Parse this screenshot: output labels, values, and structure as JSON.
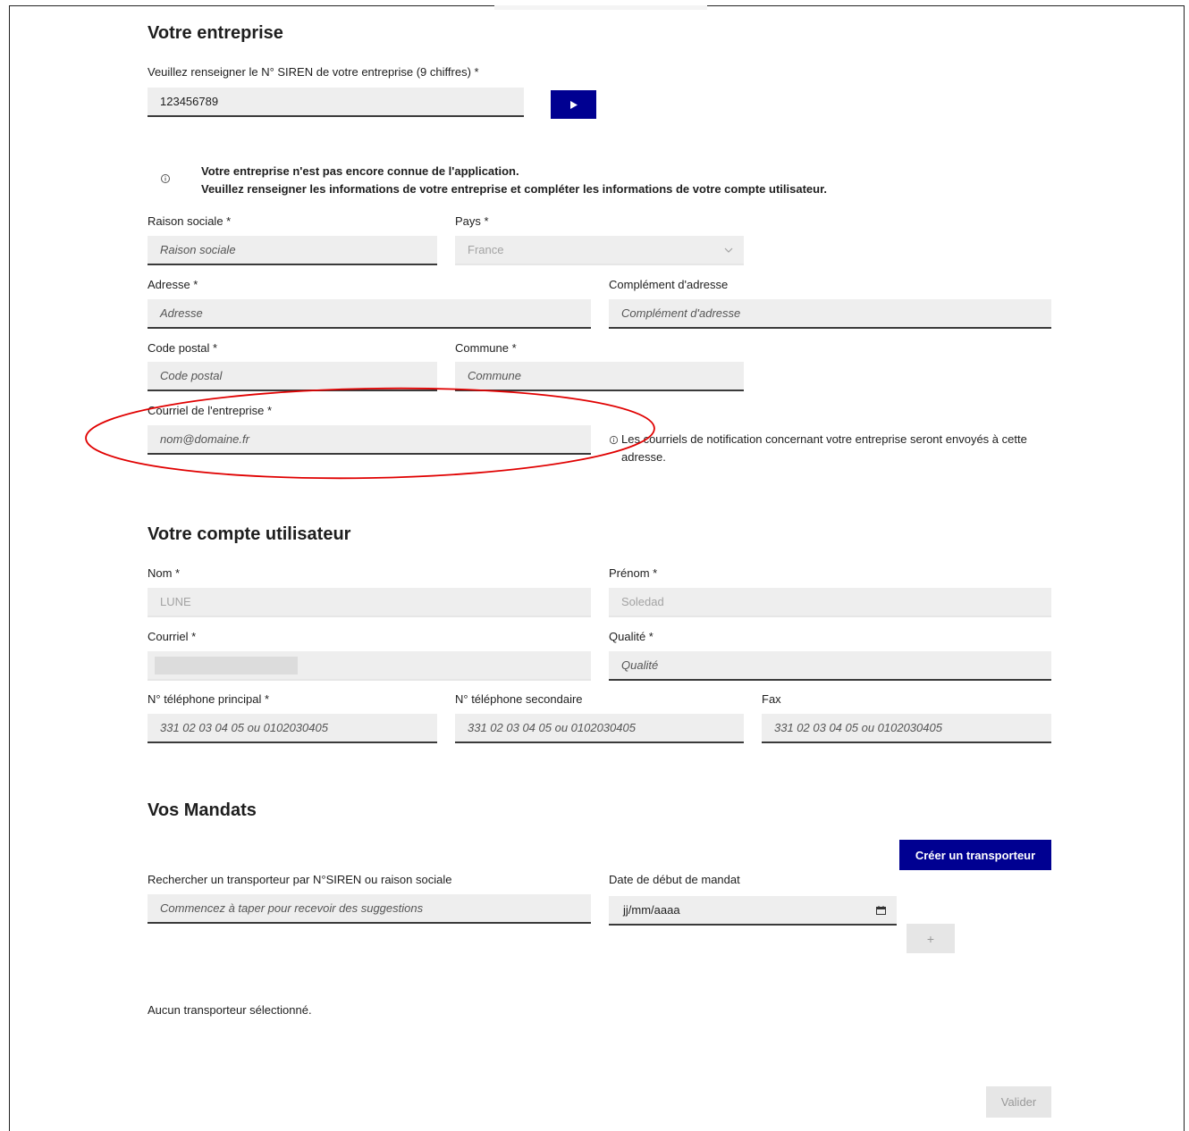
{
  "company": {
    "title": "Votre entreprise",
    "siren_label": "Veuillez renseigner le N° SIREN de votre entreprise (9 chiffres)  *",
    "siren_value": "123456789",
    "info_line1": "Votre entreprise n'est pas encore connue de l'application.",
    "info_line2": "Veuillez renseigner les informations de votre entreprise et compléter les informations de votre compte utilisateur.",
    "raison_label": "Raison sociale  *",
    "raison_placeholder": "Raison sociale",
    "pays_label": "Pays  *",
    "pays_value": "France",
    "adresse_label": "Adresse  *",
    "adresse_placeholder": "Adresse",
    "complement_label": "Complément d'adresse",
    "complement_placeholder": "Complément d'adresse",
    "cp_label": "Code postal  *",
    "cp_placeholder": "Code postal",
    "commune_label": "Commune  *",
    "commune_placeholder": "Commune",
    "courriel_label": "Courriel de l'entreprise  *",
    "courriel_placeholder": "nom@domaine.fr",
    "courriel_note": "Les courriels de notification concernant votre entreprise seront envoyés à cette adresse."
  },
  "user": {
    "title": "Votre compte utilisateur",
    "nom_label": "Nom  *",
    "nom_value": "LUNE",
    "prenom_label": "Prénom  *",
    "prenom_value": "Soledad",
    "courriel_label": "Courriel  *",
    "qualite_label": "Qualité  *",
    "qualite_placeholder": "Qualité",
    "tel1_label": "N° téléphone principal  *",
    "tel1_placeholder": "331 02 03 04 05 ou 0102030405",
    "tel2_label": "N° téléphone secondaire",
    "tel2_placeholder": "331 02 03 04 05 ou 0102030405",
    "fax_label": "Fax",
    "fax_placeholder": "331 02 03 04 05 ou 0102030405"
  },
  "mandats": {
    "title": "Vos Mandats",
    "create_button": "Créer un transporteur",
    "search_label": "Rechercher un transporteur par N°SIREN ou raison sociale",
    "search_placeholder": "Commencez à taper pour recevoir des suggestions",
    "date_label": "Date de début de mandat",
    "date_placeholder": "jj/mm/aaaa",
    "add_button": "+",
    "empty_text": "Aucun transporteur sélectionné.",
    "submit_button": "Valider"
  },
  "colors": {
    "primary": "#000091",
    "field_bg": "#eeeeee",
    "annotation": "#e00000"
  },
  "icons": [
    "play-icon",
    "info-icon",
    "chevron-down-icon",
    "calendar-icon"
  ]
}
